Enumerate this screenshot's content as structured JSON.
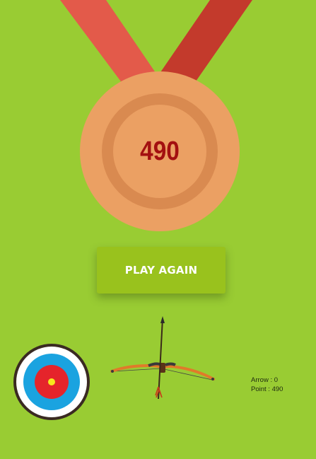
{
  "medal": {
    "score": "490",
    "ribbon_color_left": "#e35a4a",
    "ribbon_color_right": "#c33a2c",
    "medal_color": "#eba063"
  },
  "play_again": {
    "label": "PLAY AGAIN"
  },
  "stats": {
    "arrow": "Arrow : 0",
    "point": "Point : 490"
  },
  "colors": {
    "background": "#99cc33",
    "button": "#99c21d",
    "score_text": "#a31010"
  }
}
